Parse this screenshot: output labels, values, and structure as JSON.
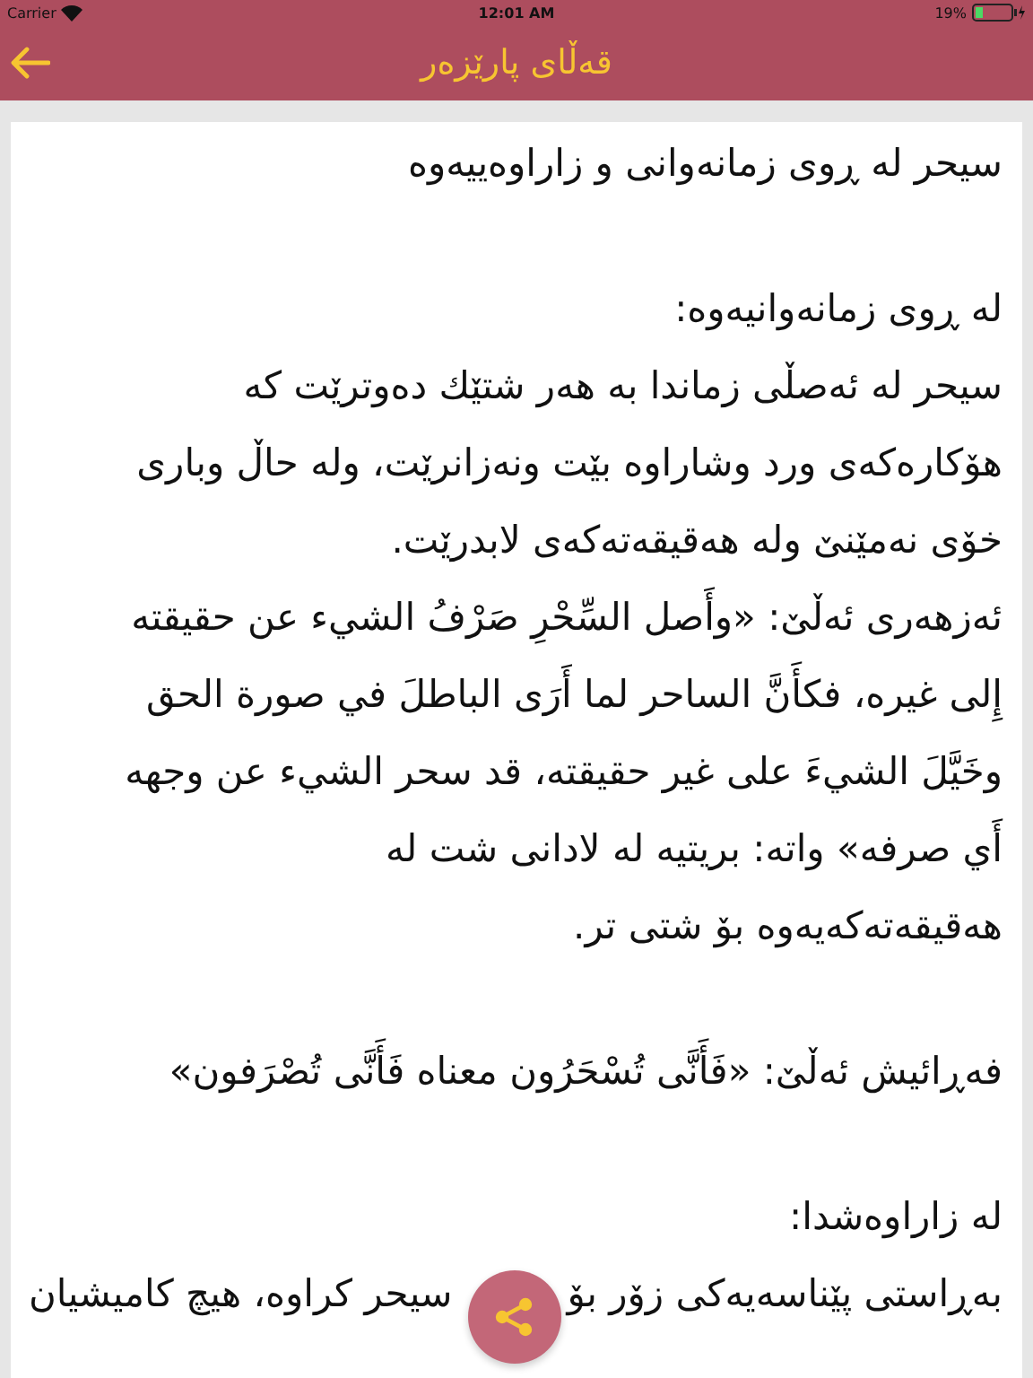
{
  "status_bar": {
    "carrier": "Carrier",
    "time": "12:01 AM",
    "battery": "19%"
  },
  "nav_bar": {
    "title": "قەڵای پارێزەر"
  },
  "article": [
    {
      "space_before": false,
      "lines": [
        "سیحر لە ڕوی زمانەوانی و زاراوەییەوە"
      ]
    },
    {
      "space_before": true,
      "lines": [
        "لە ڕوی زمانەوانیەوە:"
      ]
    },
    {
      "space_before": false,
      "lines": [
        "سیحر لە ئەصڵی زماندا بە هەر شتێك دەوترێت کە",
        "هۆکارەکەی ورد وشاراوە بێت ونەزانرێت، ولە حاڵ وباری",
        "خۆی نەمێنێ ولە هەقیقەتەکەی لابدرێت."
      ]
    },
    {
      "space_before": false,
      "lines": [
        "ئەزهەری ئەڵێ: «وأَصل السِّحْرِ صَرْفُ الشيء عن حقيقته",
        "إِلى غيره، فكأَنَّ الساحر لما أَرَى الباطلَ في صورة الحق",
        "وخَيَّلَ الشيءَ على غير حقيقته، قد سحر الشيء عن وجهه",
        "أَي صرفه» واتە: بریتیە لە لادانی شت لە",
        "هەقیقەتەکەیەوە بۆ شتی تر."
      ]
    },
    {
      "space_before": true,
      "lines": [
        "فەڕائیش ئەڵێ: «فَأَنَّى تُسْحَرُون معناه فَأَنَّى تُصْرَفون»"
      ]
    },
    {
      "space_before": true,
      "lines": [
        "لە زاراوەشدا:"
      ]
    },
    {
      "space_before": false,
      "lines": [
        [
          "بەڕاستی پێناسەیەکی زۆر بۆ",
          "سیحر کراوە، هیچ کامیشیان"
        ]
      ]
    }
  ]
}
